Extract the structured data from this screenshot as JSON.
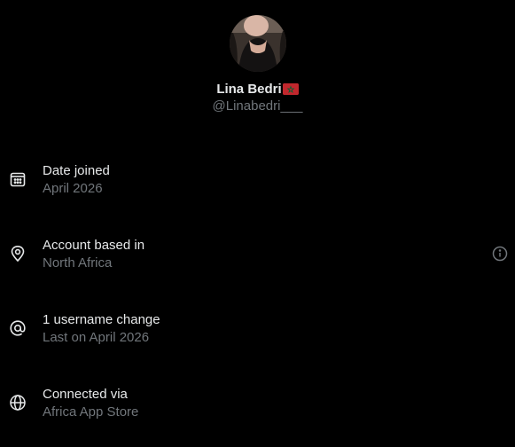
{
  "profile": {
    "display_name": "Lina Bedri",
    "handle": "@Linabedri___",
    "flag_icon": "morocco-flag-icon"
  },
  "colors": {
    "background": "#000000",
    "primary_text": "#e7e9ea",
    "secondary_text": "#71767b"
  },
  "rows": [
    {
      "icon": "calendar-icon",
      "title": "Date joined",
      "subtitle": "April 2026"
    },
    {
      "icon": "location-pin-icon",
      "title": "Account based in",
      "subtitle": "North Africa",
      "trailing_icon": "info-circle-icon"
    },
    {
      "icon": "at-sign-icon",
      "title": "1 username change",
      "subtitle": "Last on April 2026"
    },
    {
      "icon": "globe-icon",
      "title": "Connected via",
      "subtitle": "Africa App Store"
    }
  ]
}
